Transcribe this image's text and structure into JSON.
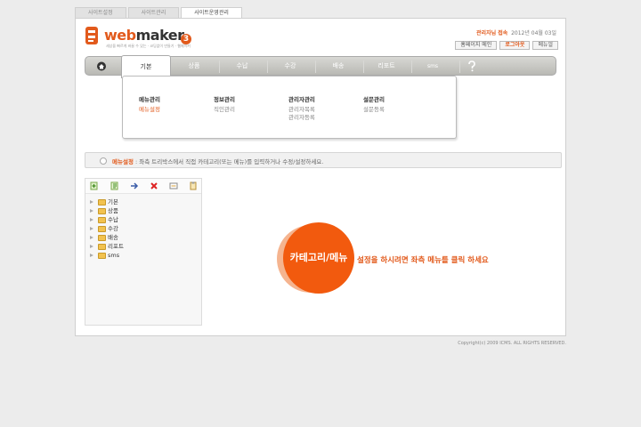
{
  "tabs": [
    {
      "label": "사이트설정",
      "active": false
    },
    {
      "label": "사이트관리",
      "active": false
    },
    {
      "label": "사이트운영관리",
      "active": true
    }
  ],
  "logo": {
    "word_orange": "web",
    "word_dark": "maker",
    "version": "3",
    "tagline": "세상을 빠르게 바꿀 수 있는 · 코딩없이 만들기 · 웹메이커"
  },
  "header": {
    "user": "관리자님 접속",
    "date": "2012년 04월 03일",
    "buttons": [
      "홈페이지 메인",
      "로그아웃",
      "메뉴얼"
    ]
  },
  "nav": {
    "home_icon": "home-icon",
    "items": [
      "기본",
      "상품",
      "수납",
      "수강",
      "배송",
      "리포트",
      "sms"
    ],
    "active": "기본",
    "help_icon": "help-icon"
  },
  "dropdown": {
    "columns": [
      {
        "title": "메뉴관리",
        "items": [
          "메뉴설정"
        ],
        "selected": "메뉴설정"
      },
      {
        "title": "정보관리",
        "items": [
          "직인관리"
        ]
      },
      {
        "title": "관리자관리",
        "items": [
          "관리자목록",
          "관리자등록"
        ]
      },
      {
        "title": "설문관리",
        "items": [
          "설문등록"
        ]
      }
    ]
  },
  "infobar": {
    "key": "메뉴설정",
    "text": " : 좌측 트리박스에서 직접 카테고리(또는 메뉴)를 입력하거나 수정/설정하세요."
  },
  "tree": {
    "tools": [
      "add-icon",
      "add-child-icon",
      "move-icon",
      "delete-icon",
      "rename-icon",
      "copy-icon"
    ],
    "nodes": [
      "기본",
      "상품",
      "수납",
      "수강",
      "배송",
      "리포트",
      "sms"
    ]
  },
  "center": {
    "label": "카테고리/메뉴",
    "message": "설정을 하시려면 좌측 메뉴를 클릭 하세요"
  },
  "footer": {
    "copyright": "Copyright(c) 2009 ICMS. ALL RIGHTS RESERVED."
  },
  "colors": {
    "accent": "#e25a1c",
    "circle": "#f25a0e",
    "circle_back": "#f5b48f"
  }
}
